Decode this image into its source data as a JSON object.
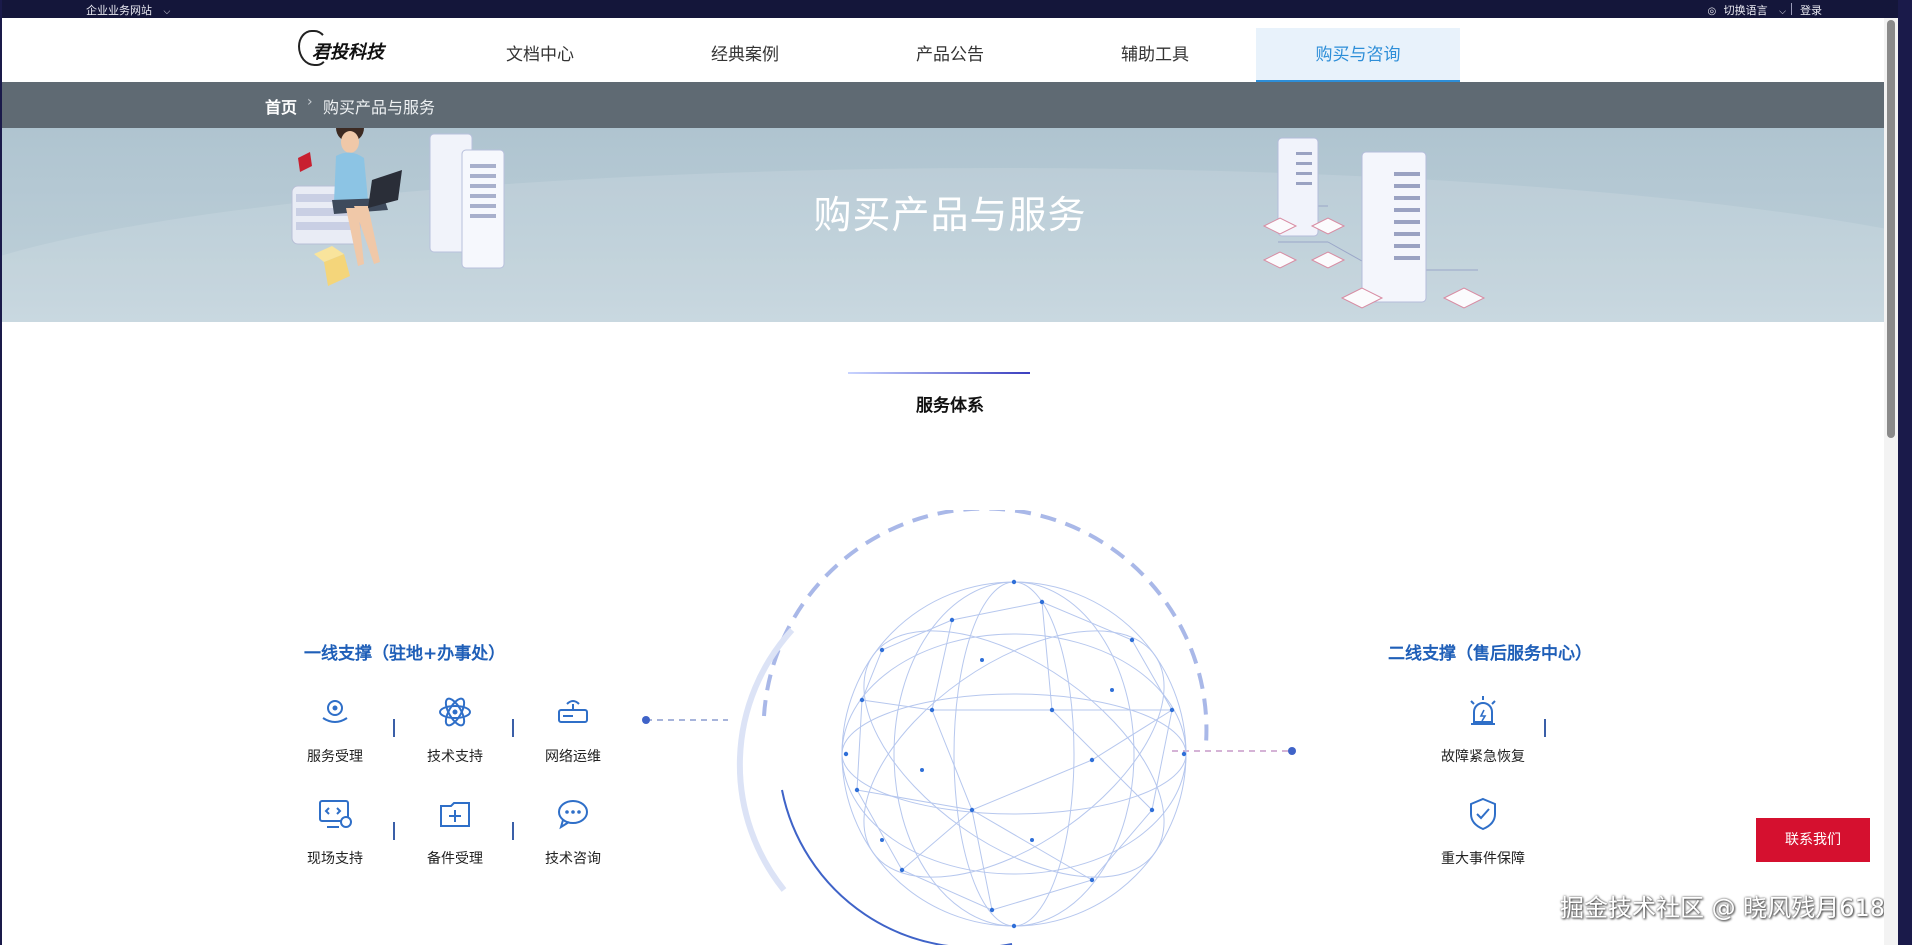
{
  "topbar": {
    "site_label": "企业业务网站",
    "lang_label": "切换语言",
    "login_label": "登录"
  },
  "logo": {
    "text": "君投科技"
  },
  "nav": {
    "items": [
      {
        "label": "文档中心"
      },
      {
        "label": "经典案例"
      },
      {
        "label": "产品公告"
      },
      {
        "label": "辅助工具"
      },
      {
        "label": "购买与咨询"
      }
    ],
    "active_index": 4
  },
  "breadcrumb": {
    "home": "首页",
    "current": "购买产品与服务"
  },
  "banner": {
    "title": "购买产品与服务"
  },
  "section": {
    "title": "服务体系"
  },
  "left": {
    "title": "一线支撑（驻地+办事处）",
    "items": [
      {
        "label": "服务受理",
        "icon": "gear-hand-icon"
      },
      {
        "label": "技术支持",
        "icon": "atom-icon"
      },
      {
        "label": "网络运维",
        "icon": "router-icon"
      },
      {
        "label": "现场支持",
        "icon": "monitor-code-icon"
      },
      {
        "label": "备件受理",
        "icon": "folder-plus-icon"
      },
      {
        "label": "技术咨询",
        "icon": "chat-icon"
      }
    ]
  },
  "right": {
    "title": "二线支撑（售后服务中心）",
    "items": [
      {
        "label": "故障紧急恢复",
        "icon": "alarm-icon"
      },
      {
        "label": "重大事件保障",
        "icon": "shield-check-icon"
      }
    ]
  },
  "contact_label": "联系我们",
  "watermark": "掘金技术社区 @ 晓风残月618",
  "colors": {
    "accent": "#1f5fb8",
    "nav_active": "#2d8ed8",
    "contact": "#d5102f",
    "breadcrumb_bg": "#5f6a73"
  }
}
